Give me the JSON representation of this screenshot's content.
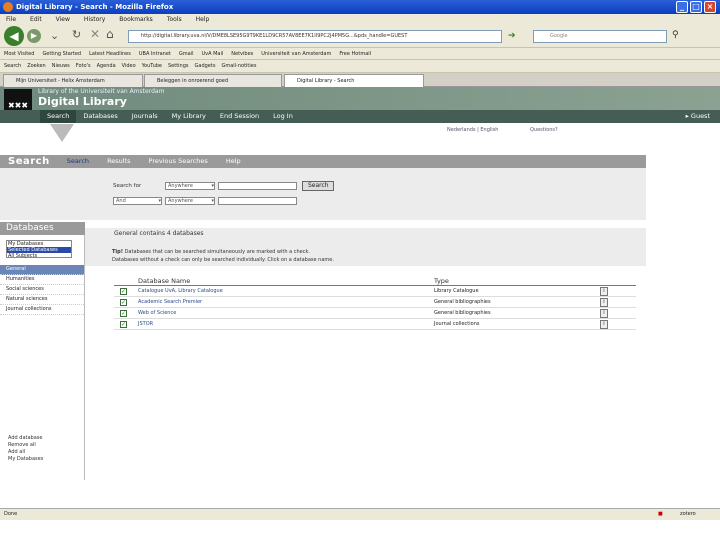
{
  "window": {
    "title": "Digital Library - Search - Mozilla Firefox"
  },
  "menu": [
    "File",
    "Edit",
    "View",
    "History",
    "Bookmarks",
    "Tools",
    "Help"
  ],
  "url": "http://digital.library.uva.nl/V/DME8LSE95G9T9KE1LD9CR57AV8EE7K1II9PC2J4PM5G...&pds_handle=GUEST",
  "search_placeholder": "Google",
  "bookmarks": [
    "Most Visited",
    "Getting Started",
    "Latest Headlines",
    "UBA Intranet",
    "Gmail",
    "UvA Mail",
    "Netvibes",
    "Universiteit van Amsterdam",
    "Free Hotmail"
  ],
  "toolbar2_items": [
    "Search",
    "Zoeken",
    "Nieuws",
    "Foto's",
    "Agenda",
    "Video",
    "YouTube",
    "Settings",
    "Gadgets",
    "Gmail-notities"
  ],
  "tabs": [
    "Mijn Universiteit - Helix Amsterdam",
    "Beleggen in onroerend goed",
    "Digital Library - Search"
  ],
  "site": {
    "subtitle": "Library of the Universiteit van Amsterdam",
    "title": "Digital Library",
    "logo_symbol": "✖✖✖",
    "nav": [
      "Search",
      "Databases",
      "Journals",
      "My Library",
      "End Session",
      "Log In"
    ],
    "guest": "Guest",
    "links": [
      "Nederlands | English",
      "Questions?"
    ]
  },
  "search": {
    "title": "Search",
    "tabs": [
      "Search",
      "Results",
      "Previous Searches",
      "Help"
    ],
    "search_for_label": "Search for",
    "field1": "Anywhere",
    "bool": "And",
    "field2": "Anywhere",
    "button": "Search"
  },
  "databases": {
    "title": "Databases",
    "mydb": "My Databases",
    "selected_set": "Selected Databases",
    "all_subjects": "All Subjects",
    "categories": [
      "General",
      "Humanities",
      "Social sciences",
      "Natural sciences",
      "Journal collections"
    ],
    "links": [
      "Add database",
      "Remove all",
      "Add all",
      "My Databases"
    ]
  },
  "info": {
    "group": "General contains 4 databases",
    "tip_bold": "Tip!",
    "tip_text": "Databases that can be searched simultaneously are marked with a check.",
    "line2": "Databases without a check can only be searched individually. Click on a database name."
  },
  "table": {
    "col_name": "Database Name",
    "col_type": "Type",
    "rows": [
      {
        "name": "Catalogue UvA, Library Catalogue",
        "type": "Library Catalogue"
      },
      {
        "name": "Academic Search Premier",
        "type": "General bibliographies"
      },
      {
        "name": "Web of Science",
        "type": "General bibliographies"
      },
      {
        "name": "JSTOR",
        "type": "Journal collections"
      }
    ]
  },
  "status": {
    "left": "Done",
    "right": "zotero"
  }
}
